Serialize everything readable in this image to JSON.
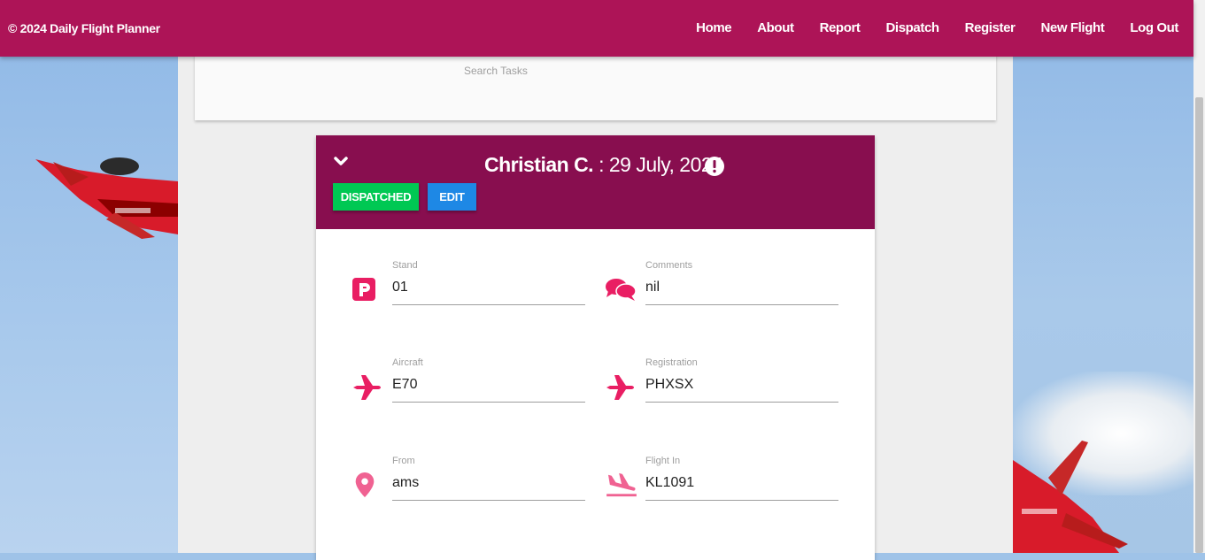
{
  "nav": {
    "brand": "© 2024 Daily Flight Planner",
    "links": [
      "Home",
      "About",
      "Report",
      "Dispatch",
      "Register",
      "New Flight",
      "Log Out"
    ]
  },
  "search": {
    "label": "Search Tasks"
  },
  "card": {
    "name": "Christian C.",
    "date": ": 29 July, 2024",
    "buttons": {
      "dispatched": "DISPATCHED",
      "edit": "EDIT"
    },
    "fields": {
      "stand": {
        "label": "Stand",
        "value": "01",
        "icon": "parking-icon"
      },
      "comments": {
        "label": "Comments",
        "value": "nil",
        "icon": "comments-icon"
      },
      "aircraft": {
        "label": "Aircraft",
        "value": "E70",
        "icon": "plane-icon"
      },
      "registration": {
        "label": "Registration",
        "value": "PHXSX",
        "icon": "plane-icon"
      },
      "from": {
        "label": "From",
        "value": "ams",
        "icon": "map-marker-icon"
      },
      "flight_in": {
        "label": "Flight In",
        "value": "KL1091",
        "icon": "plane-arrival-icon"
      }
    }
  },
  "colors": {
    "nav": "#ad1457",
    "card_header": "#880e4f",
    "icon": "#e91e63",
    "dispatched": "#00c853",
    "edit": "#1e88e5"
  }
}
